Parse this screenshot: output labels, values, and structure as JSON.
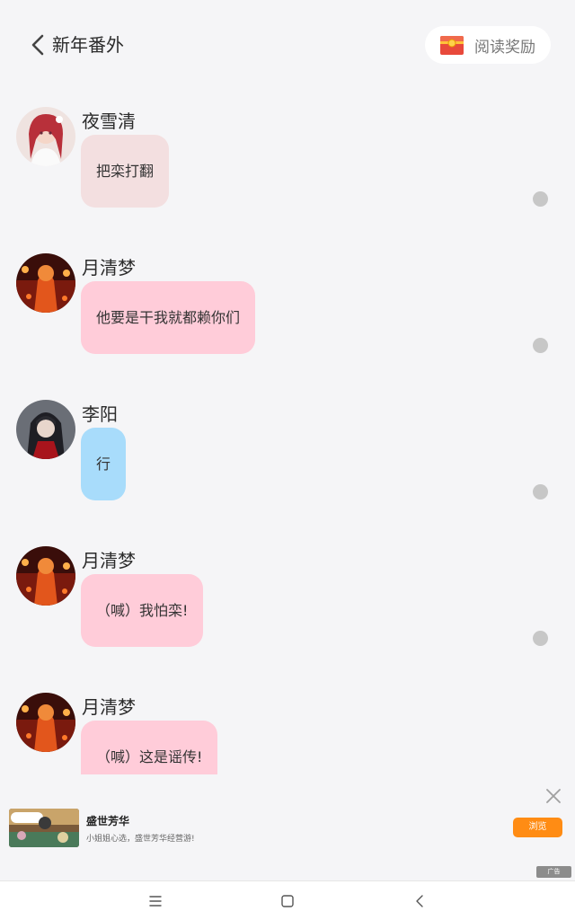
{
  "header": {
    "title": "新年番外",
    "reward_label": "阅读奖励"
  },
  "messages": [
    {
      "sender": "夜雪清",
      "text": "把栾打翻",
      "bubble_color": "#f3dfe0"
    },
    {
      "sender": "月清梦",
      "text": "他要是干我就都赖你们",
      "bubble_color": "#ffccd9"
    },
    {
      "sender": "李阳",
      "text": "行",
      "bubble_color": "#a8dcfb"
    },
    {
      "sender": "月清梦",
      "text": "（喊）我怕栾!",
      "bubble_color": "#ffccd9"
    },
    {
      "sender": "月清梦",
      "text": "（喊）这是谣传!",
      "bubble_color": "#ffccd9"
    }
  ],
  "ad": {
    "title": "盛世芳华",
    "desc": "小姐姐心选，盛世芳华经营游!",
    "button": "浏览",
    "badge": "广告",
    "button_color": "#ff8c14"
  },
  "icons": {
    "back": "chevron-left-icon",
    "reward": "red-envelope-icon",
    "close": "close-icon",
    "nav_menu": "menu-icon",
    "nav_home": "square-icon",
    "nav_back": "chevron-left-icon"
  }
}
